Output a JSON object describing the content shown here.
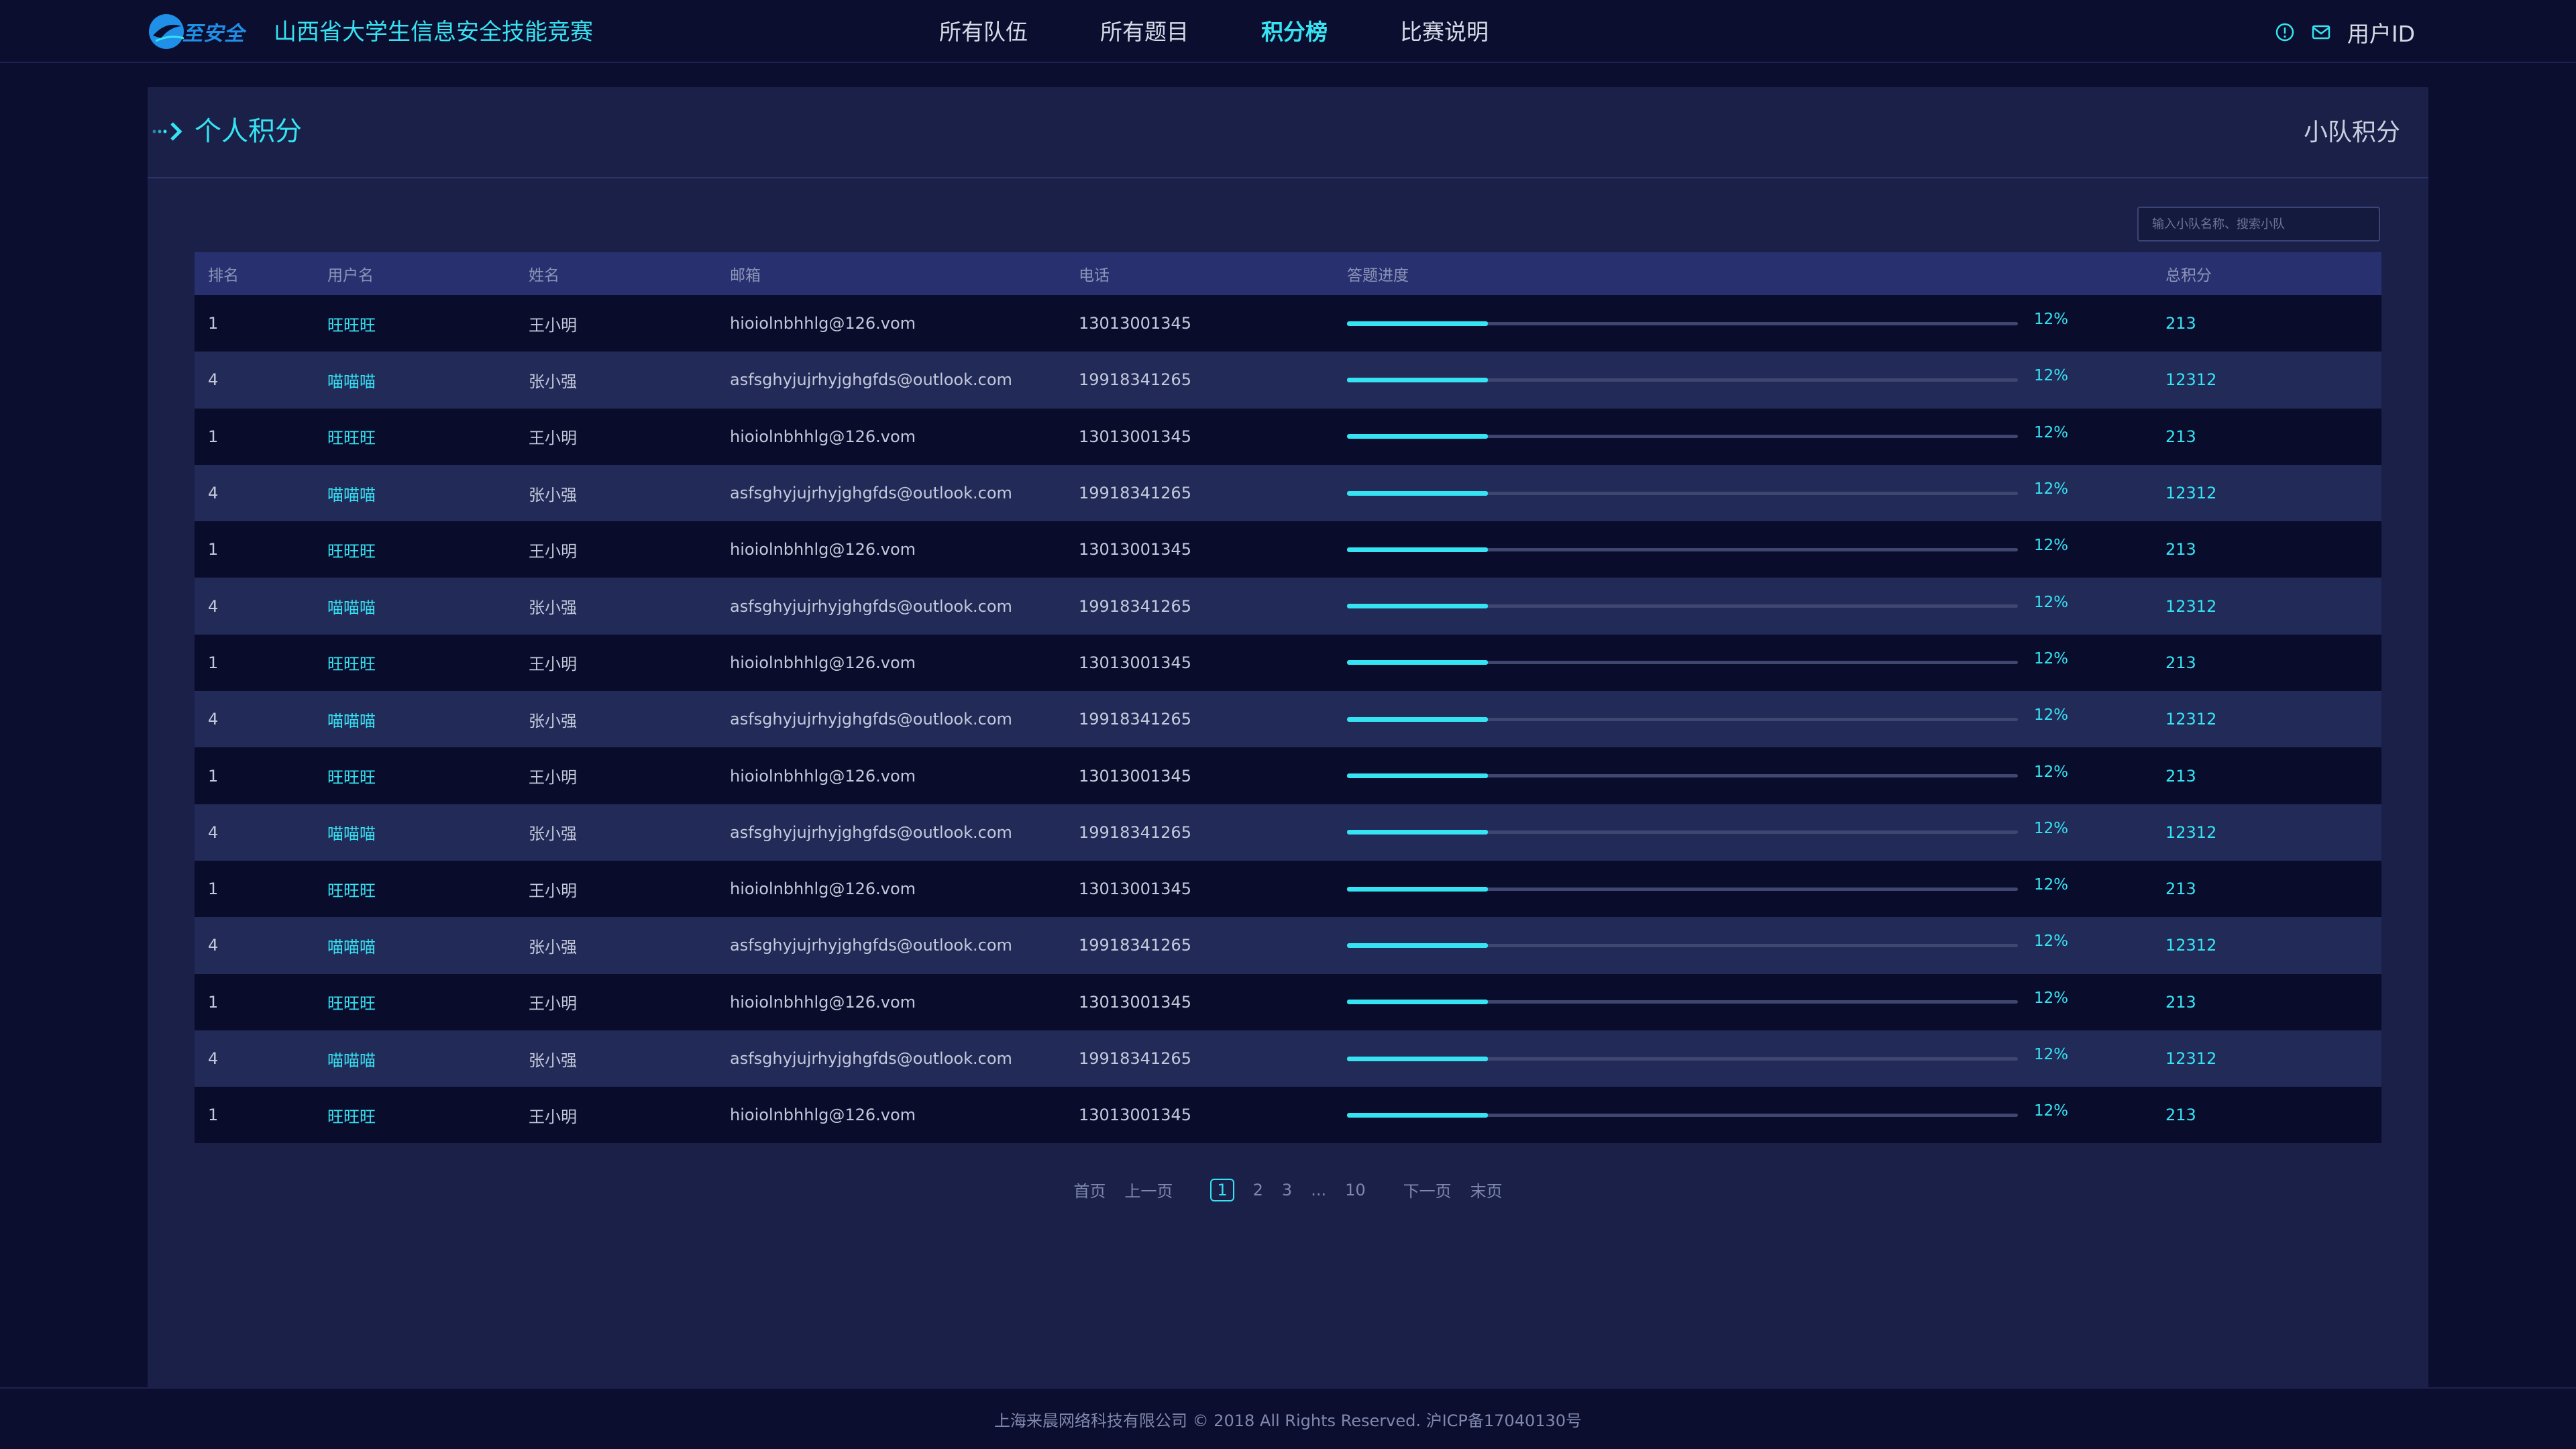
{
  "header": {
    "logo_text": "至安全",
    "site_title": "山西省大学生信息安全技能竞赛",
    "nav": [
      {
        "label": "所有队伍",
        "active": false
      },
      {
        "label": "所有题目",
        "active": false
      },
      {
        "label": "积分榜",
        "active": true
      },
      {
        "label": "比赛说明",
        "active": false
      }
    ],
    "user_id": "用户ID",
    "icons": [
      "info-icon",
      "mail-icon"
    ]
  },
  "panel": {
    "title": "个人积分",
    "team_score_link": "小队积分",
    "search_placeholder": "输入小队名称、搜索小队"
  },
  "table": {
    "headers": [
      "排名",
      "用户名",
      "姓名",
      "邮箱",
      "电话",
      "答题进度",
      "总积分"
    ],
    "rows": [
      {
        "rank": "1",
        "username": "旺旺旺",
        "name": "王小明",
        "email": "hioiolnbhhlg@126.vom",
        "phone": "13013001345",
        "progress": 0.12,
        "progress_label": "12%",
        "total": "213"
      },
      {
        "rank": "4",
        "username": "喵喵喵",
        "name": "张小强",
        "email": "asfsghyjujrhyjghgfds@outlook.com",
        "phone": "19918341265",
        "progress": 0.12,
        "progress_label": "12%",
        "total": "12312"
      },
      {
        "rank": "1",
        "username": "旺旺旺",
        "name": "王小明",
        "email": "hioiolnbhhlg@126.vom",
        "phone": "13013001345",
        "progress": 0.12,
        "progress_label": "12%",
        "total": "213"
      },
      {
        "rank": "4",
        "username": "喵喵喵",
        "name": "张小强",
        "email": "asfsghyjujrhyjghgfds@outlook.com",
        "phone": "19918341265",
        "progress": 0.12,
        "progress_label": "12%",
        "total": "12312"
      },
      {
        "rank": "1",
        "username": "旺旺旺",
        "name": "王小明",
        "email": "hioiolnbhhlg@126.vom",
        "phone": "13013001345",
        "progress": 0.12,
        "progress_label": "12%",
        "total": "213"
      },
      {
        "rank": "4",
        "username": "喵喵喵",
        "name": "张小强",
        "email": "asfsghyjujrhyjghgfds@outlook.com",
        "phone": "19918341265",
        "progress": 0.12,
        "progress_label": "12%",
        "total": "12312"
      },
      {
        "rank": "1",
        "username": "旺旺旺",
        "name": "王小明",
        "email": "hioiolnbhhlg@126.vom",
        "phone": "13013001345",
        "progress": 0.12,
        "progress_label": "12%",
        "total": "213"
      },
      {
        "rank": "4",
        "username": "喵喵喵",
        "name": "张小强",
        "email": "asfsghyjujrhyjghgfds@outlook.com",
        "phone": "19918341265",
        "progress": 0.12,
        "progress_label": "12%",
        "total": "12312"
      },
      {
        "rank": "1",
        "username": "旺旺旺",
        "name": "王小明",
        "email": "hioiolnbhhlg@126.vom",
        "phone": "13013001345",
        "progress": 0.12,
        "progress_label": "12%",
        "total": "213"
      },
      {
        "rank": "4",
        "username": "喵喵喵",
        "name": "张小强",
        "email": "asfsghyjujrhyjghgfds@outlook.com",
        "phone": "19918341265",
        "progress": 0.12,
        "progress_label": "12%",
        "total": "12312"
      },
      {
        "rank": "1",
        "username": "旺旺旺",
        "name": "王小明",
        "email": "hioiolnbhhlg@126.vom",
        "phone": "13013001345",
        "progress": 0.12,
        "progress_label": "12%",
        "total": "213"
      },
      {
        "rank": "4",
        "username": "喵喵喵",
        "name": "张小强",
        "email": "asfsghyjujrhyjghgfds@outlook.com",
        "phone": "19918341265",
        "progress": 0.12,
        "progress_label": "12%",
        "total": "12312"
      },
      {
        "rank": "1",
        "username": "旺旺旺",
        "name": "王小明",
        "email": "hioiolnbhhlg@126.vom",
        "phone": "13013001345",
        "progress": 0.12,
        "progress_label": "12%",
        "total": "213"
      },
      {
        "rank": "4",
        "username": "喵喵喵",
        "name": "张小强",
        "email": "asfsghyjujrhyjghgfds@outlook.com",
        "phone": "19918341265",
        "progress": 0.12,
        "progress_label": "12%",
        "total": "12312"
      },
      {
        "rank": "1",
        "username": "旺旺旺",
        "name": "王小明",
        "email": "hioiolnbhhlg@126.vom",
        "phone": "13013001345",
        "progress": 0.12,
        "progress_label": "12%",
        "total": "213"
      }
    ]
  },
  "pagination": {
    "first": "首页",
    "prev": "上一页",
    "pages": [
      "1",
      "2",
      "3"
    ],
    "ellipsis": "...",
    "last_page": "10",
    "current": "1",
    "next": "下一页",
    "last": "末页"
  },
  "footer": {
    "text": "上海来晨网络科技有限公司 © 2018 All Rights Reserved.  沪ICP备17040130号"
  },
  "colors": {
    "accent": "#35e3f2",
    "background": "#0c0e2f",
    "panel": "#1a2048",
    "table_header": "#283070",
    "row_dark": "#0a0c2c",
    "row_light": "#222a58"
  }
}
